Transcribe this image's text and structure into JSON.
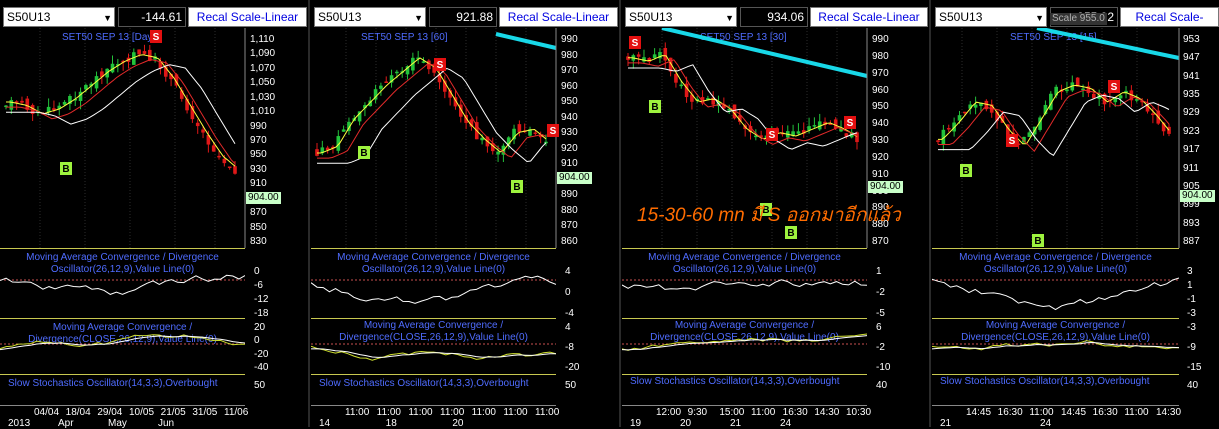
{
  "panels": [
    {
      "symbol": "S50U13",
      "price": "-144.61",
      "recal": "Recal Scale-Linear",
      "title": "SET50 SEP 13",
      "period": "[Day]",
      "current": "904.00",
      "yticks": [
        "1,110",
        "1,090",
        "1,070",
        "1,050",
        "1,030",
        "1,010",
        "990",
        "970",
        "950",
        "930",
        "910",
        "890",
        "870",
        "850",
        "830"
      ],
      "macd1": {
        "label1": "Moving Average Convergence / Divergence",
        "label2": "Oscillator(26,12,9),Value Line(0)",
        "yticks": [
          "0",
          "-6",
          "-12",
          "-18"
        ]
      },
      "macd2": {
        "label1": "Moving Average Convergence /",
        "label2": "Divergence(CLOSE,26,12,9),Value Line(0)",
        "yticks": [
          "20",
          "0",
          "-20",
          "-40"
        ]
      },
      "stoch": {
        "label": "Slow Stochastics Oscillator(14,3,3),Overbought",
        "yticks": [
          "50"
        ]
      },
      "xaxis": [
        "04/04",
        "18/04",
        "29/04",
        "10/05",
        "21/05",
        "31/05",
        "11/06"
      ],
      "xdates": [
        "2013",
        "Apr",
        "May",
        "Jun"
      ]
    },
    {
      "symbol": "S50U13",
      "price": "921.88",
      "recal": "Recal Scale-Linear",
      "title": "SET50 SEP 13",
      "period": "[60]",
      "current": "904.00",
      "yticks": [
        "990",
        "980",
        "970",
        "960",
        "950",
        "940",
        "930",
        "920",
        "910",
        "900",
        "890",
        "880",
        "870",
        "860"
      ],
      "macd1": {
        "label1": "Moving Average Convergence / Divergence",
        "label2": "Oscillator(26,12,9),Value Line(0)",
        "yticks": [
          "4",
          "0",
          "-4"
        ]
      },
      "macd2": {
        "label1": "Moving Average Convergence /",
        "label2": "Divergence(CLOSE,26,12,9),Value Line(0)",
        "yticks": [
          "4",
          "-8",
          "-20"
        ]
      },
      "stoch": {
        "label": "Slow Stochastics Oscillator(14,3,3),Overbought",
        "yticks": [
          "50"
        ]
      },
      "xaxis": [
        "11:00",
        "11:00",
        "11:00",
        "11:00",
        "11:00",
        "11:00",
        "11:00"
      ],
      "xdates": [
        "14",
        "18",
        "20"
      ]
    },
    {
      "symbol": "S50U13",
      "price": "934.06",
      "recal": "Recal Scale-Linear",
      "title": "SET50 SEP 13",
      "period": "[30]",
      "current": "904.00",
      "yticks": [
        "990",
        "980",
        "970",
        "960",
        "950",
        "940",
        "930",
        "920",
        "910",
        "900",
        "890",
        "880",
        "870"
      ],
      "macd1": {
        "label1": "Moving Average Convergence / Divergence",
        "label2": "Oscillator(26,12,9),Value Line(0)",
        "yticks": [
          "1",
          "-2",
          "-5"
        ]
      },
      "macd2": {
        "label1": "Moving Average Convergence /",
        "label2": "Divergence(CLOSE,26,12,9),Value Line(0)",
        "yticks": [
          "6",
          "-2",
          "-10"
        ]
      },
      "stoch": {
        "label": "Slow Stochastics Oscillator(14,3,3),Overbought",
        "yticks": [
          "40"
        ]
      },
      "xaxis": [
        "12:00",
        "9:30",
        "15:00",
        "11:00",
        "16:30",
        "14:30",
        "10:30"
      ],
      "xdates": [
        "19",
        "20",
        "21",
        "24"
      ]
    },
    {
      "symbol": "S50U13",
      "price": "955.02",
      "overlay": "Scale 955.0",
      "recal": "Recal Scale-Linea",
      "title": "SET50 SEP 13",
      "period": "[15]",
      "current": "904.00",
      "yticks": [
        "953",
        "947",
        "941",
        "935",
        "929",
        "923",
        "917",
        "911",
        "905",
        "899",
        "893",
        "887"
      ],
      "macd1": {
        "label1": "Moving Average Convergence / Divergence",
        "label2": "Oscillator(26,12,9),Value Line(0)",
        "yticks": [
          "3",
          "1",
          "-1",
          "-3"
        ]
      },
      "macd2": {
        "label1": "Moving Average Convergence /",
        "label2": "Divergence(CLOSE,26,12,9),Value Line(0)",
        "yticks": [
          "-3",
          "-9",
          "-15"
        ]
      },
      "stoch": {
        "label": "Slow Stochastics Oscillator(14,3,3),Overbought",
        "yticks": [
          "40"
        ]
      },
      "xaxis": [
        "14:45",
        "16:30",
        "11:00",
        "14:45",
        "16:30",
        "11:00",
        "14:30"
      ],
      "xdates": [
        "21",
        "24"
      ]
    }
  ],
  "signals": {
    "buy": "B",
    "sell": "S"
  },
  "annotation": "15-30-60 mn มี S ออกมาอีกแล้ว",
  "colors": {
    "up": "#22c33a",
    "down": "#e01818",
    "ma_fast": "#ffff40",
    "ma_mid": "#e22a2a",
    "ma_slow": "#ffffff",
    "trend": "#18d8e8",
    "macd": "#ffffff",
    "signal": "#d0e030",
    "accent": "#4f6cff"
  }
}
